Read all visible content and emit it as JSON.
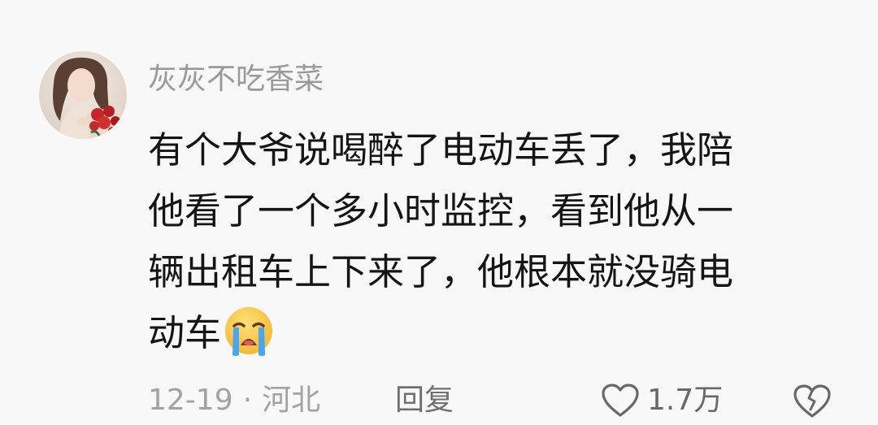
{
  "comment": {
    "username": "灰灰不吃香菜",
    "text_lines": [
      "有个大爷说喝醉了电动车丢了，我陪",
      "他看了一个多小时监控，看到他从一",
      "辆出租车上下来了，他根本就没骑电",
      "动车"
    ],
    "emoji": "crying-face-emoji",
    "date": "12-19",
    "separator": "·",
    "location": "河北",
    "reply_label": "回复",
    "like_count": "1.7万"
  },
  "colors": {
    "background": "#f8f8f8",
    "username": "#9a9a9a",
    "text": "#151515",
    "meta": "#a2a2a2",
    "action": "#686868"
  }
}
